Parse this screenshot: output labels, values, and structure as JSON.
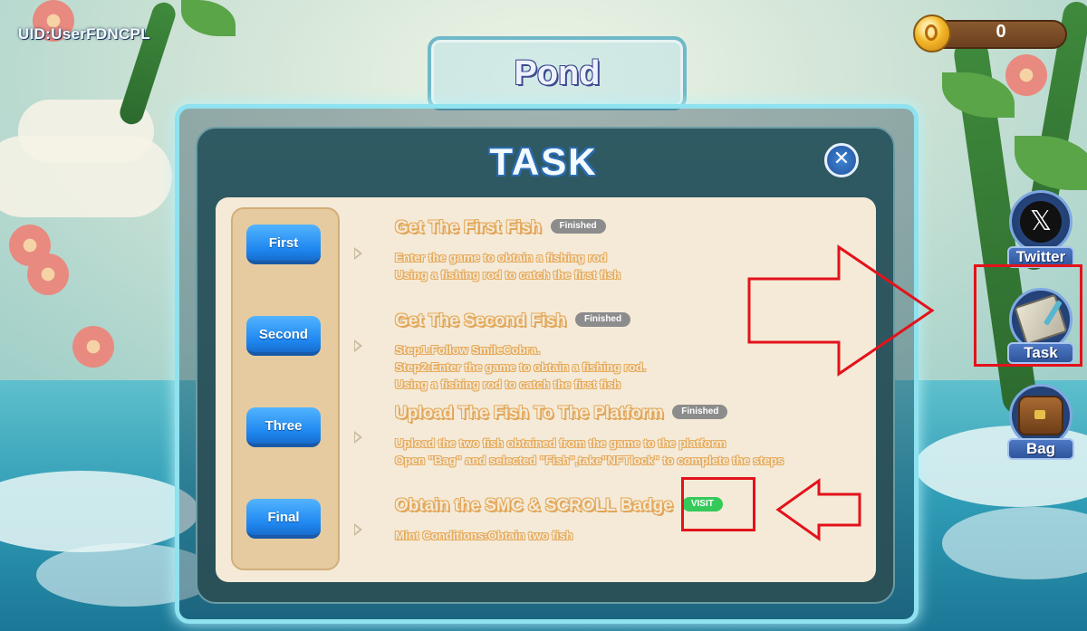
{
  "hud": {
    "uid": "UID:UserFDNCPL",
    "coins": "0",
    "scene_title": "Pond"
  },
  "side_menu": [
    {
      "label": "Twitter",
      "icon": "x-logo-icon"
    },
    {
      "label": "Task",
      "icon": "task-notes-icon"
    },
    {
      "label": "Bag",
      "icon": "treasure-bag-icon"
    }
  ],
  "dialog": {
    "title": "TASK",
    "close_icon": "close-icon",
    "tasks": [
      {
        "step": "First",
        "title": "Get The First Fish",
        "status": "Finished",
        "lines": [
          "Enter the game to obtain a fishing rod",
          "Using a fishing rod to catch the first fish"
        ]
      },
      {
        "step": "Second",
        "title": "Get The Second Fish",
        "status": "Finished",
        "lines": [
          "Step1:Follow SmileCobra.",
          "Step2:Enter the game to obtain a fishing rod.",
          "Using a fishing rod to catch the first fish"
        ]
      },
      {
        "step": "Three",
        "title": "Upload The Fish To The Platform",
        "status": "Finished",
        "lines": [
          "Upload the two fish obtained from the game to the platform",
          "Open \"Bag\" and selected \"Fish\",take\"NFTlock\" to complete the steps"
        ]
      },
      {
        "step": "Final",
        "title": "Obtain the SMC & SCROLL Badge",
        "status": "VISIT",
        "lines": [
          "Mint Conditions:Obtain two fish"
        ]
      }
    ]
  },
  "colors": {
    "annotation_red": "#e3121b",
    "step_button_blue": "#1e86ef",
    "finished_badge": "#8c8c8c",
    "visit_badge": "#35c95a"
  }
}
